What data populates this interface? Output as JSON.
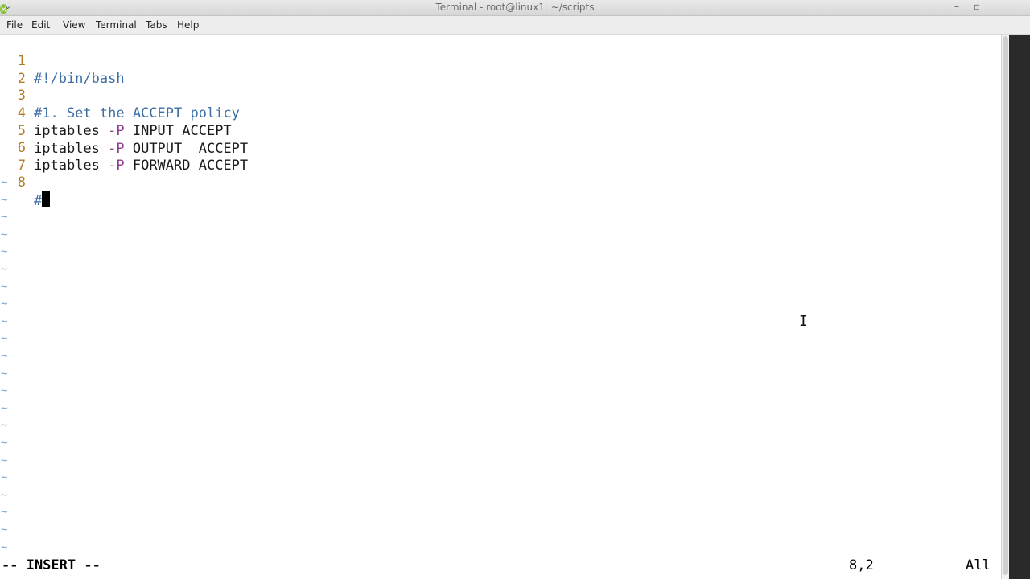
{
  "window": {
    "title": "Terminal - root@linux1: ~/scripts",
    "menu_glyph": "⌄",
    "minimize_glyph": "–",
    "maximize_glyph": "▫",
    "close_glyph": "×",
    "close_color": "#8cc43f"
  },
  "menubar": {
    "items": [
      "File",
      "Edit",
      "View",
      "Terminal",
      "Tabs",
      "Help"
    ]
  },
  "editor": {
    "lines": [
      {
        "num": "1",
        "text": "#!/bin/bash"
      },
      {
        "num": "2",
        "text": ""
      },
      {
        "num": "3",
        "text": "#1. Set the ACCEPT policy"
      },
      {
        "num": "4",
        "cmd": "iptables ",
        "flag": "-P",
        "rest": " INPUT ACCEPT"
      },
      {
        "num": "5",
        "cmd": "iptables ",
        "flag": "-P",
        "rest": " OUTPUT  ACCEPT"
      },
      {
        "num": "6",
        "cmd": "iptables ",
        "flag": "-P",
        "rest": " FORWARD ACCEPT"
      },
      {
        "num": "7",
        "text": ""
      },
      {
        "num": "8",
        "text": "#"
      }
    ],
    "tilde": "~",
    "comment_color": "#3b6ea5",
    "line_number_color": "#b07a22",
    "flag_color": "#8e3c8e"
  },
  "status": {
    "mode": "-- INSERT --",
    "position": "8,2",
    "scroll": "All"
  }
}
